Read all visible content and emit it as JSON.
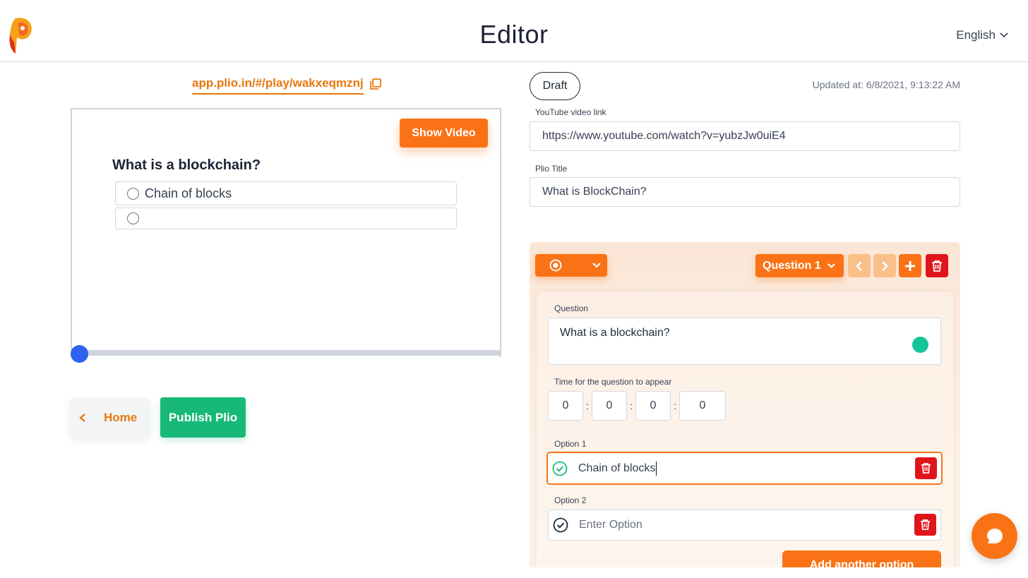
{
  "header": {
    "title": "Editor",
    "language": "English"
  },
  "left": {
    "plio_link": "app.plio.in/#/play/wakxeqmznj",
    "show_video_label": "Show Video",
    "preview_question": "What is a blockchain?",
    "preview_options": [
      "Chain of blocks",
      ""
    ],
    "home_label": "Home",
    "publish_label": "Publish Plio"
  },
  "right": {
    "status": "Draft",
    "updated_at": "Updated at: 6/8/2021, 9:13:22 AM",
    "video_link_label": "YouTube video link",
    "video_link_value": "https://www.youtube.com/watch?v=yubzJw0uiE4",
    "plio_title_label": "Plio Title",
    "plio_title_value": "What is BlockChain?"
  },
  "editor": {
    "question_selector": "Question 1",
    "question_label": "Question",
    "question_text": "What is a blockchain?",
    "time_label": "Time for the question to appear",
    "time": [
      "0",
      "0",
      "0",
      "0"
    ],
    "time_separator": ":",
    "options": [
      {
        "label": "Option 1",
        "value": "Chain of blocks",
        "placeholder": "Enter Option"
      },
      {
        "label": "Option 2",
        "value": "",
        "placeholder": "Enter Option"
      }
    ],
    "add_option_label": "Add another option"
  },
  "colors": {
    "brand_orange": "#f97316",
    "link_orange": "#e8770e",
    "publish_green": "#18b978",
    "delete_red": "#e0151b",
    "progress_blue": "#2e63f0"
  },
  "icons": [
    "plio-logo-icon",
    "chevron-down-icon",
    "copy-icon",
    "chevron-left-icon",
    "radio-type-icon",
    "chevron-left-icon",
    "chevron-right-icon",
    "plus-icon",
    "trash-icon",
    "check-circle-icon",
    "grammarly-icon",
    "chat-icon"
  ]
}
